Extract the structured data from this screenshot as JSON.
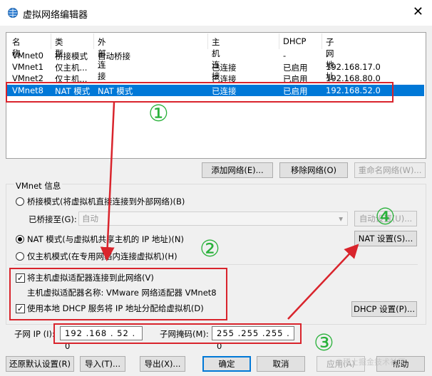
{
  "window": {
    "title": "虚拟网络编辑器",
    "close_glyph": "✕"
  },
  "network_list": {
    "headers": [
      "名称",
      "类型",
      "外部连接",
      "主机连接",
      "DHCP",
      "子网地址"
    ],
    "rows": [
      [
        "VMnet0",
        "桥接模式",
        "自动桥接",
        "-",
        "-",
        "-"
      ],
      [
        "VMnet1",
        "仅主机...",
        "-",
        "已连接",
        "已启用",
        "192.168.17.0"
      ],
      [
        "VMnet2",
        "仅主机...",
        "-",
        "已连接",
        "已启用",
        "192.168.80.0"
      ],
      [
        "VMnet8",
        "NAT 模式",
        "NAT 模式",
        "已连接",
        "已启用",
        "192.168.52.0"
      ]
    ],
    "selected_index": 3
  },
  "list_buttons": {
    "add": "添加网络(E)...",
    "remove": "移除网络(O)",
    "rename": "重命名网络(W)..."
  },
  "vmnet_info": {
    "group_label": "VMnet 信息",
    "bridged_radio": "桥接模式(将虚拟机直接连接到外部网络)(B)",
    "bridged_to_label": "已桥接至(G):",
    "bridged_to_value": "自动",
    "auto_settings": "自动设置(U)...",
    "nat_radio": "NAT 模式(与虚拟机共享主机的 IP 地址)(N)",
    "nat_settings": "NAT 设置(S)...",
    "hostonly_radio": "仅主机模式(在专用网络内连接虚拟机)(H)",
    "connect_adapter": "将主机虚拟适配器连接到此网络(V)",
    "adapter_name": "主机虚拟适配器名称: VMware 网络适配器 VMnet8",
    "use_dhcp": "使用本地 DHCP 服务将 IP 地址分配给虚拟机(D)",
    "dhcp_settings": "DHCP 设置(P)...",
    "subnet_ip_label": "子网 IP (I):",
    "subnet_ip": "192 .168 . 52 . 0",
    "subnet_mask_label": "子网掩码(M):",
    "subnet_mask": "255 .255 .255 . 0"
  },
  "bottom_buttons": {
    "restore": "还原默认设置(R)",
    "import": "导入(T)...",
    "export": "导出(X)...",
    "ok": "确定",
    "cancel": "取消",
    "apply": "应用(A)",
    "help": "帮助"
  },
  "annotations": {
    "one": "①",
    "two": "②",
    "three": "③",
    "four": "④"
  },
  "watermark": "@稀土掘金技术社区",
  "colors": {
    "selection": "#0078d7",
    "annotation_red": "#d9242c",
    "annotation_green": "#29b13a"
  }
}
